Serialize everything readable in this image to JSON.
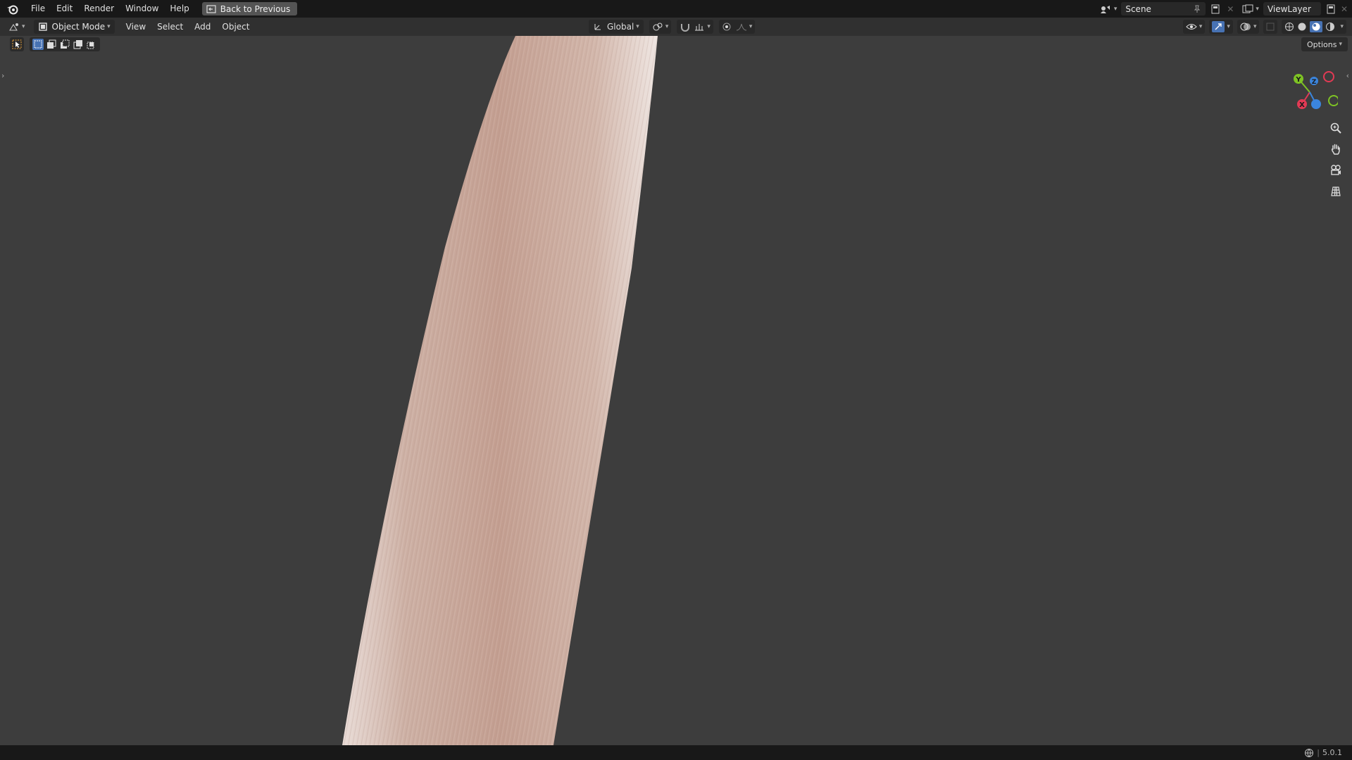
{
  "topbar": {
    "menus": [
      "File",
      "Edit",
      "Render",
      "Window",
      "Help"
    ],
    "back_button": "Back to Previous",
    "scene": "Scene",
    "view_layer": "ViewLayer"
  },
  "header": {
    "mode": "Object Mode",
    "menus": [
      "View",
      "Select",
      "Add",
      "Object"
    ],
    "orientation": "Global",
    "options": "Options"
  },
  "gizmo": {
    "axes": {
      "x": "X",
      "y": "Y",
      "z": "Z"
    },
    "colors": {
      "x": "#e23a54",
      "y": "#7ec324",
      "z": "#3b85dd"
    }
  },
  "viewport": {
    "object": "hair-strand-mesh",
    "background": "#3d3d3d",
    "object_color": "#c9a89a"
  },
  "status": {
    "version": "5.0.1"
  },
  "icons": {
    "app": "blender-logo-icon",
    "back": "back-arrow-icon",
    "scene": "scene-icon",
    "layer": "view-layer-icon",
    "zoom": "zoom-icon",
    "pan": "hand-icon",
    "camera": "camera-icon",
    "ortho": "grid-icon",
    "network": "network-icon"
  }
}
